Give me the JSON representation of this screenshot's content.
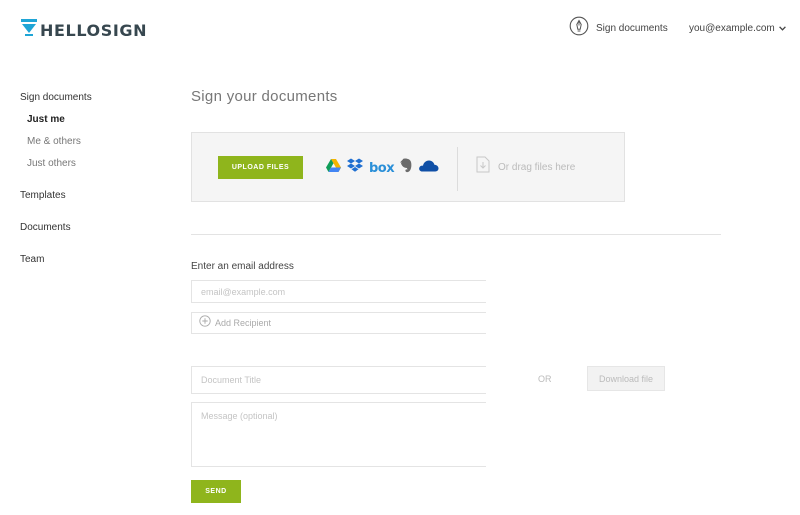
{
  "brand": {
    "name": "HELLOSIGN",
    "logo_color": "#1fa5d6",
    "text_color": "#37474f"
  },
  "header": {
    "sign_documents_icon": "pen-circle-icon",
    "sign_documents_label": "Sign documents",
    "user_email": "you@example.com",
    "user_menu_icon": "chevron-down-icon"
  },
  "sidebar": {
    "sign_documents": "Sign documents",
    "sub_items": [
      {
        "label": "Just me",
        "active": true
      },
      {
        "label": "Me & others",
        "active": false
      },
      {
        "label": "Just others",
        "active": false
      }
    ],
    "templates": "Templates",
    "documents": "Documents",
    "team": "Team"
  },
  "main": {
    "title": "Sign your documents",
    "upload": {
      "button_label": "UPLOAD FILES",
      "cloud_services": [
        "google-drive-icon",
        "dropbox-icon",
        "box-icon",
        "evernote-icon",
        "onedrive-icon"
      ],
      "box_label": "box",
      "drag_label": "Or drag files here",
      "drag_icon": "file-drop-icon"
    },
    "email_section": {
      "label": "Enter an email address",
      "email_placeholder": "email@example.com",
      "add_recipient_label": "Add Recipient",
      "add_icon": "plus-circle-icon"
    },
    "document_title_placeholder": "Document Title",
    "or_label": "OR",
    "download_label": "Download file",
    "message_placeholder": "Message (optional)",
    "send_label": "SEND"
  },
  "colors": {
    "accent_green": "#8fb51c",
    "panel_bg": "#f5f5f5"
  }
}
